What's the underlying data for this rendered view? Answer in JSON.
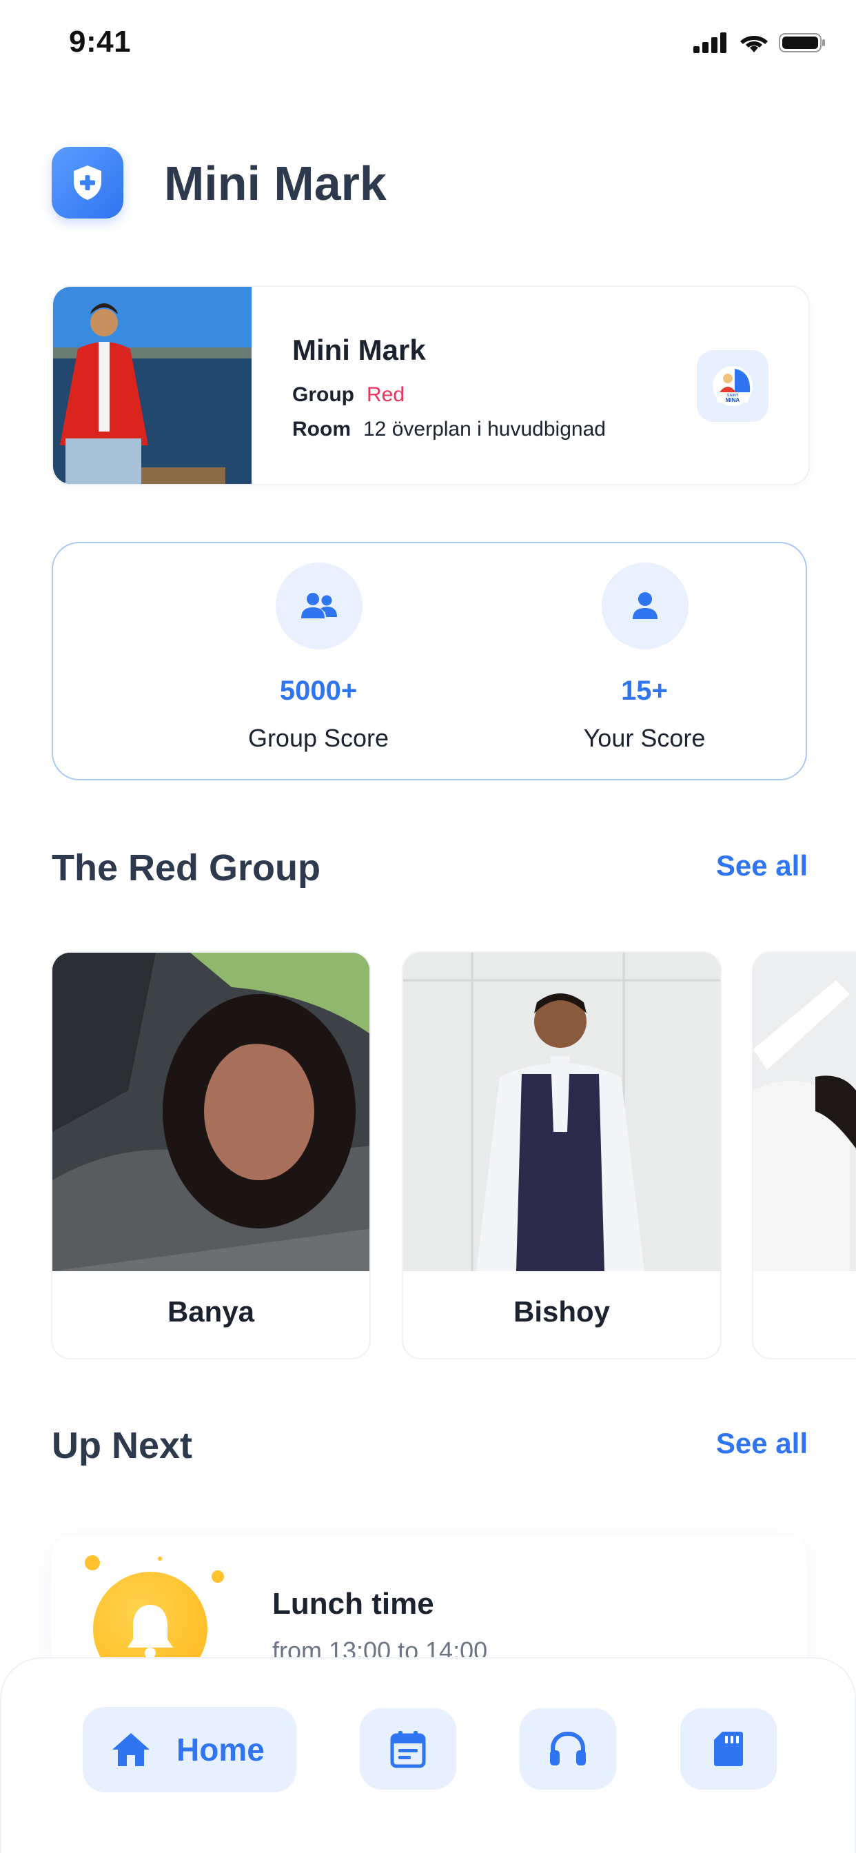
{
  "status_bar": {
    "time": "9:41"
  },
  "header": {
    "title": "Mini Mark"
  },
  "profile": {
    "name": "Mini Mark",
    "group_label": "Group",
    "group_value": "Red",
    "room_label": "Room",
    "room_value": "12 överplan i huvudbignad",
    "badge_text": "SAINT MINA"
  },
  "scores": {
    "group": {
      "value": "5000+",
      "label": "Group Score"
    },
    "you": {
      "value": "15+",
      "label": "Your Score"
    }
  },
  "group_section": {
    "title": "The Red Group",
    "see_all": "See all"
  },
  "members": [
    {
      "name": "Banya"
    },
    {
      "name": "Bishoy"
    },
    {
      "name": ""
    }
  ],
  "up_next": {
    "title": "Up Next",
    "see_all": "See all",
    "event_title": "Lunch time",
    "event_time": "from 13:00 to 14:00"
  },
  "nav": {
    "home_label": "Home"
  },
  "colors": {
    "accent": "#2f74f0",
    "accent_light": "#e7f0ff",
    "group_red": "#e8335a",
    "event_yellow": "#ffc22e"
  }
}
